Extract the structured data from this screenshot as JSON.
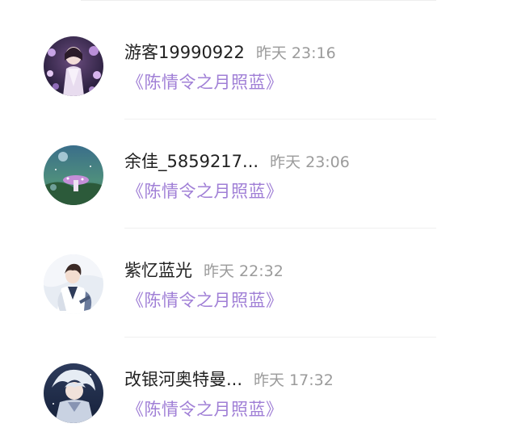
{
  "feed": {
    "items": [
      {
        "username": "游客19990922",
        "time": "昨天 23:16",
        "book": "《陈情令之月照蓝》",
        "avatar_icon": "girl-portrait-avatar"
      },
      {
        "username": "余佳_5859217...",
        "time": "昨天 23:06",
        "book": "《陈情令之月照蓝》",
        "avatar_icon": "fantasy-mushroom-avatar"
      },
      {
        "username": "紫忆蓝光",
        "time": "昨天 22:32",
        "book": "《陈情令之月照蓝》",
        "avatar_icon": "anime-boy-avatar"
      },
      {
        "username": "改银河奥特曼...",
        "time": "昨天 17:32",
        "book": "《陈情令之月照蓝》",
        "avatar_icon": "white-hair-anime-avatar"
      }
    ]
  },
  "colors": {
    "book_title": "#a07fd6",
    "timestamp": "#9b9b9b",
    "username": "#222222"
  }
}
